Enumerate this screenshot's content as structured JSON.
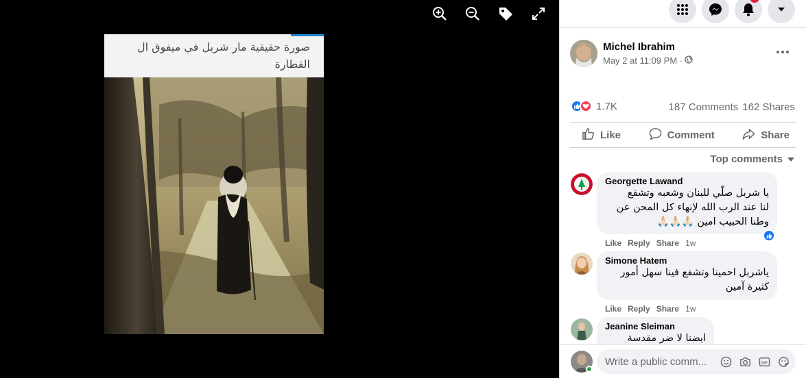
{
  "viewer": {
    "tools": [
      "zoom-in-icon",
      "zoom-out-icon",
      "tag-icon",
      "fullscreen-icon"
    ],
    "caption_line1": "صورة حقيقية مار شربل في ميفوق ال",
    "caption_line2": "القطارة"
  },
  "header_icons": [
    "menu-grid-icon",
    "messenger-icon",
    "notifications-icon",
    "account-dropdown-icon"
  ],
  "post": {
    "author": "Michel Ibrahim",
    "date": "May 2 at 11:09 PM ·",
    "privacy_icon": "globe-icon",
    "reaction_count": "1.7K",
    "comments": "187 Comments",
    "shares": "162 Shares"
  },
  "actions": {
    "like": "Like",
    "comment": "Comment",
    "share": "Share"
  },
  "sort_label": "Top comments",
  "comments": [
    {
      "name": "Georgette Lawand",
      "line1": "يا شربل صلّي للبنان وشعبه وتشفع",
      "line2": "لنا عند الرب الله لإنهاء كل المحن عن",
      "line3": "وطنا الحبيب امين 🙏🏻🙏🏻🙏🏻",
      "like": "Like",
      "reply": "Reply",
      "share": "Share",
      "time": "1w"
    },
    {
      "name": "Simone Hatem",
      "line1": "ياشربل احمينا وتشفع فينا سهل أمور",
      "line2": "كثيرة آمين",
      "like": "Like",
      "reply": "Reply",
      "share": "Share",
      "time": "1w"
    },
    {
      "name": "Jeanine Sleiman",
      "line1": "ايضنا لا ضر مقدسة"
    }
  ],
  "composer": {
    "placeholder": "Write a public comm...",
    "icons": [
      "emoji-icon",
      "camera-icon",
      "gif-icon",
      "sticker-icon"
    ]
  },
  "colors": {
    "brand": "#1877f2",
    "love": "#f33e58",
    "notif": "#e41e3f"
  }
}
